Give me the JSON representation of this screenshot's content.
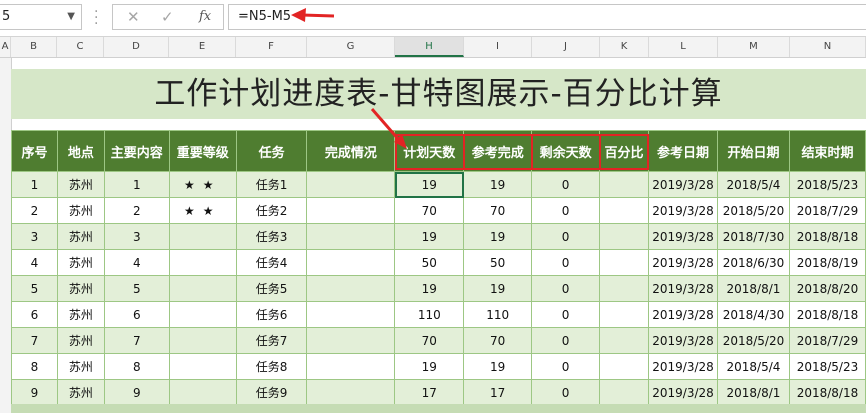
{
  "formula_bar": {
    "name_box": "5",
    "cancel_icon": "✕",
    "enter_icon": "✓",
    "fx_label": "fx",
    "formula": "=N5-M5"
  },
  "column_headers": [
    "A",
    "B",
    "C",
    "D",
    "E",
    "F",
    "G",
    "H",
    "I",
    "J",
    "K",
    "L",
    "M",
    "N"
  ],
  "selected_column": "H",
  "sheet": {
    "title": "工作计划进度表-甘特图展示-百分比计算",
    "headers": [
      "序号",
      "地点",
      "主要内容",
      "重要等级",
      "任务",
      "完成情况",
      "计划天数",
      "参考完成",
      "剩余天数",
      "百分比",
      "参考日期",
      "开始日期",
      "结束时期"
    ],
    "rows": [
      {
        "no": "1",
        "place": "苏州",
        "content": "1",
        "stars": "★★",
        "task": "任务1",
        "status": "",
        "plan": "19",
        "ref": "19",
        "remain": "0",
        "pct": "",
        "refdate": "2019/3/28",
        "start": "2018/5/4",
        "end": "2018/5/23"
      },
      {
        "no": "2",
        "place": "苏州",
        "content": "2",
        "stars": "★★",
        "task": "任务2",
        "status": "",
        "plan": "70",
        "ref": "70",
        "remain": "0",
        "pct": "",
        "refdate": "2019/3/28",
        "start": "2018/5/20",
        "end": "2018/7/29"
      },
      {
        "no": "3",
        "place": "苏州",
        "content": "3",
        "stars": "",
        "task": "任务3",
        "status": "",
        "plan": "19",
        "ref": "19",
        "remain": "0",
        "pct": "",
        "refdate": "2019/3/28",
        "start": "2018/7/30",
        "end": "2018/8/18"
      },
      {
        "no": "4",
        "place": "苏州",
        "content": "4",
        "stars": "",
        "task": "任务4",
        "status": "",
        "plan": "50",
        "ref": "50",
        "remain": "0",
        "pct": "",
        "refdate": "2019/3/28",
        "start": "2018/6/30",
        "end": "2018/8/19"
      },
      {
        "no": "5",
        "place": "苏州",
        "content": "5",
        "stars": "",
        "task": "任务5",
        "status": "",
        "plan": "19",
        "ref": "19",
        "remain": "0",
        "pct": "",
        "refdate": "2019/3/28",
        "start": "2018/8/1",
        "end": "2018/8/20"
      },
      {
        "no": "6",
        "place": "苏州",
        "content": "6",
        "stars": "",
        "task": "任务6",
        "status": "",
        "plan": "110",
        "ref": "110",
        "remain": "0",
        "pct": "",
        "refdate": "2019/3/28",
        "start": "2018/4/30",
        "end": "2018/8/18"
      },
      {
        "no": "7",
        "place": "苏州",
        "content": "7",
        "stars": "",
        "task": "任务7",
        "status": "",
        "plan": "70",
        "ref": "70",
        "remain": "0",
        "pct": "",
        "refdate": "2019/3/28",
        "start": "2018/5/20",
        "end": "2018/7/29"
      },
      {
        "no": "8",
        "place": "苏州",
        "content": "8",
        "stars": "",
        "task": "任务8",
        "status": "",
        "plan": "19",
        "ref": "19",
        "remain": "0",
        "pct": "",
        "refdate": "2019/3/28",
        "start": "2018/5/4",
        "end": "2018/5/23"
      },
      {
        "no": "9",
        "place": "苏州",
        "content": "9",
        "stars": "",
        "task": "任务9",
        "status": "",
        "plan": "17",
        "ref": "17",
        "remain": "0",
        "pct": "",
        "refdate": "2019/3/28",
        "start": "2018/8/1",
        "end": "2018/8/18"
      }
    ]
  },
  "colors": {
    "header_green": "#4f7d30",
    "band_green": "#e3efd8",
    "title_green": "#d6e7c8",
    "highlight_red": "#e22424",
    "star_red": "#e8261f"
  }
}
